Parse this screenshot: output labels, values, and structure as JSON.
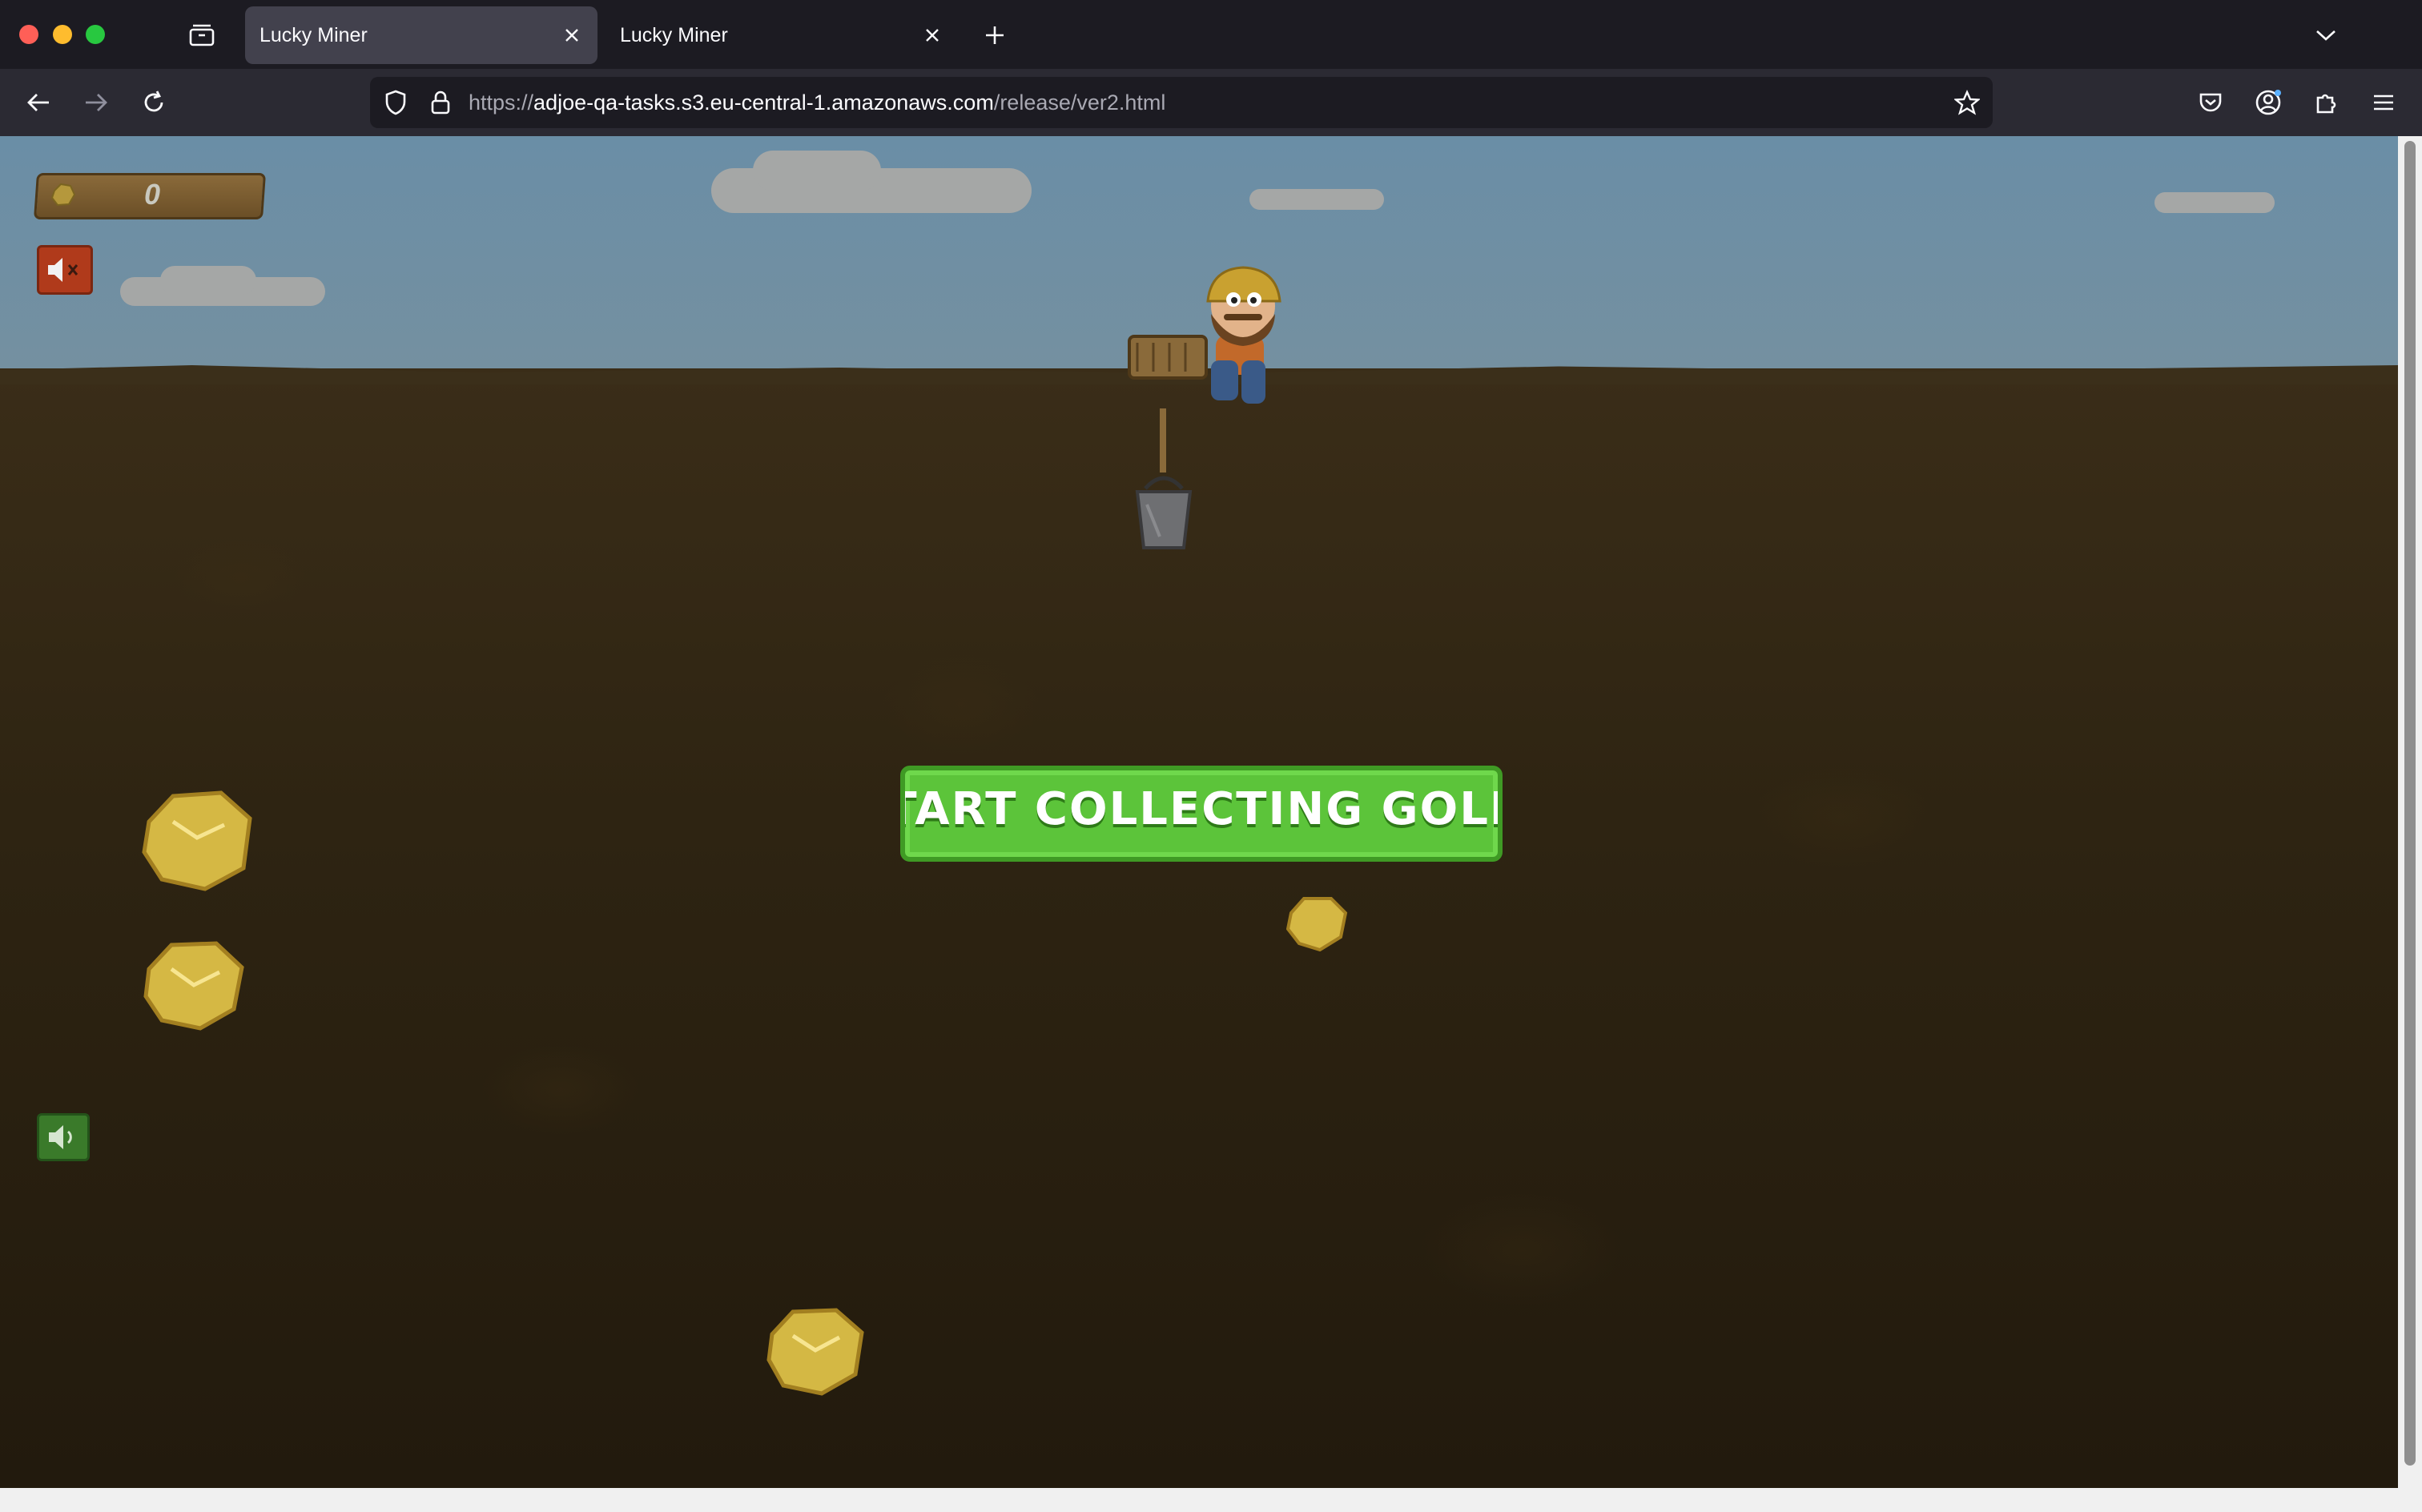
{
  "browser": {
    "tabs": [
      {
        "label": "Lucky Miner",
        "active": true
      },
      {
        "label": "Lucky Miner",
        "active": false
      }
    ],
    "url": {
      "scheme": "https://",
      "host": "adjoe-qa-tasks.s3.eu-central-1.amazonaws.com",
      "path": "/release/ver2.html"
    }
  },
  "game": {
    "title": "Lucky Miner",
    "score": "0",
    "start_banner": "START COLLECTING GOLD!",
    "sound_state": "muted",
    "colors": {
      "sky": "#7590a0",
      "ground": "#2e2412",
      "banner_green": "#5cc43a",
      "gold": "#e8c94a"
    },
    "nugget_count": 4
  }
}
